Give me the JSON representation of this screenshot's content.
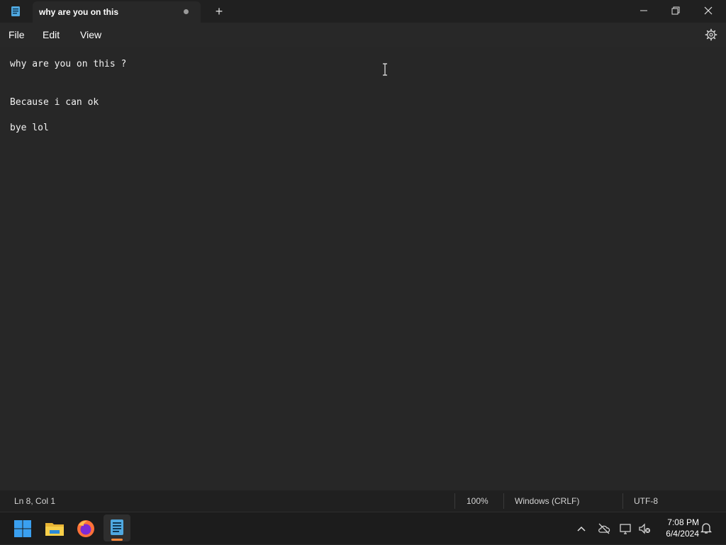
{
  "window": {
    "tab_title": "why are you on this",
    "new_tab_label": "+",
    "unsaved_indicator": true
  },
  "menu": {
    "file": "File",
    "edit": "Edit",
    "view": "View"
  },
  "editor": {
    "lines": [
      "why are you on this ?",
      "Because i can ok",
      "bye lol"
    ]
  },
  "status": {
    "position": "Ln 8, Col 1",
    "zoom": "100%",
    "line_ending": "Windows (CRLF)",
    "encoding": "UTF-8"
  },
  "taskbar": {
    "apps": [
      "start-icon",
      "file-explorer-icon",
      "firefox-icon",
      "notepad-icon"
    ],
    "active_app": "notepad-icon",
    "time": "7:08 PM",
    "date": "6/4/2024"
  },
  "colors": {
    "background": "#272727",
    "titlebar": "#202020",
    "accent_indicator": "#ff8a3d"
  }
}
